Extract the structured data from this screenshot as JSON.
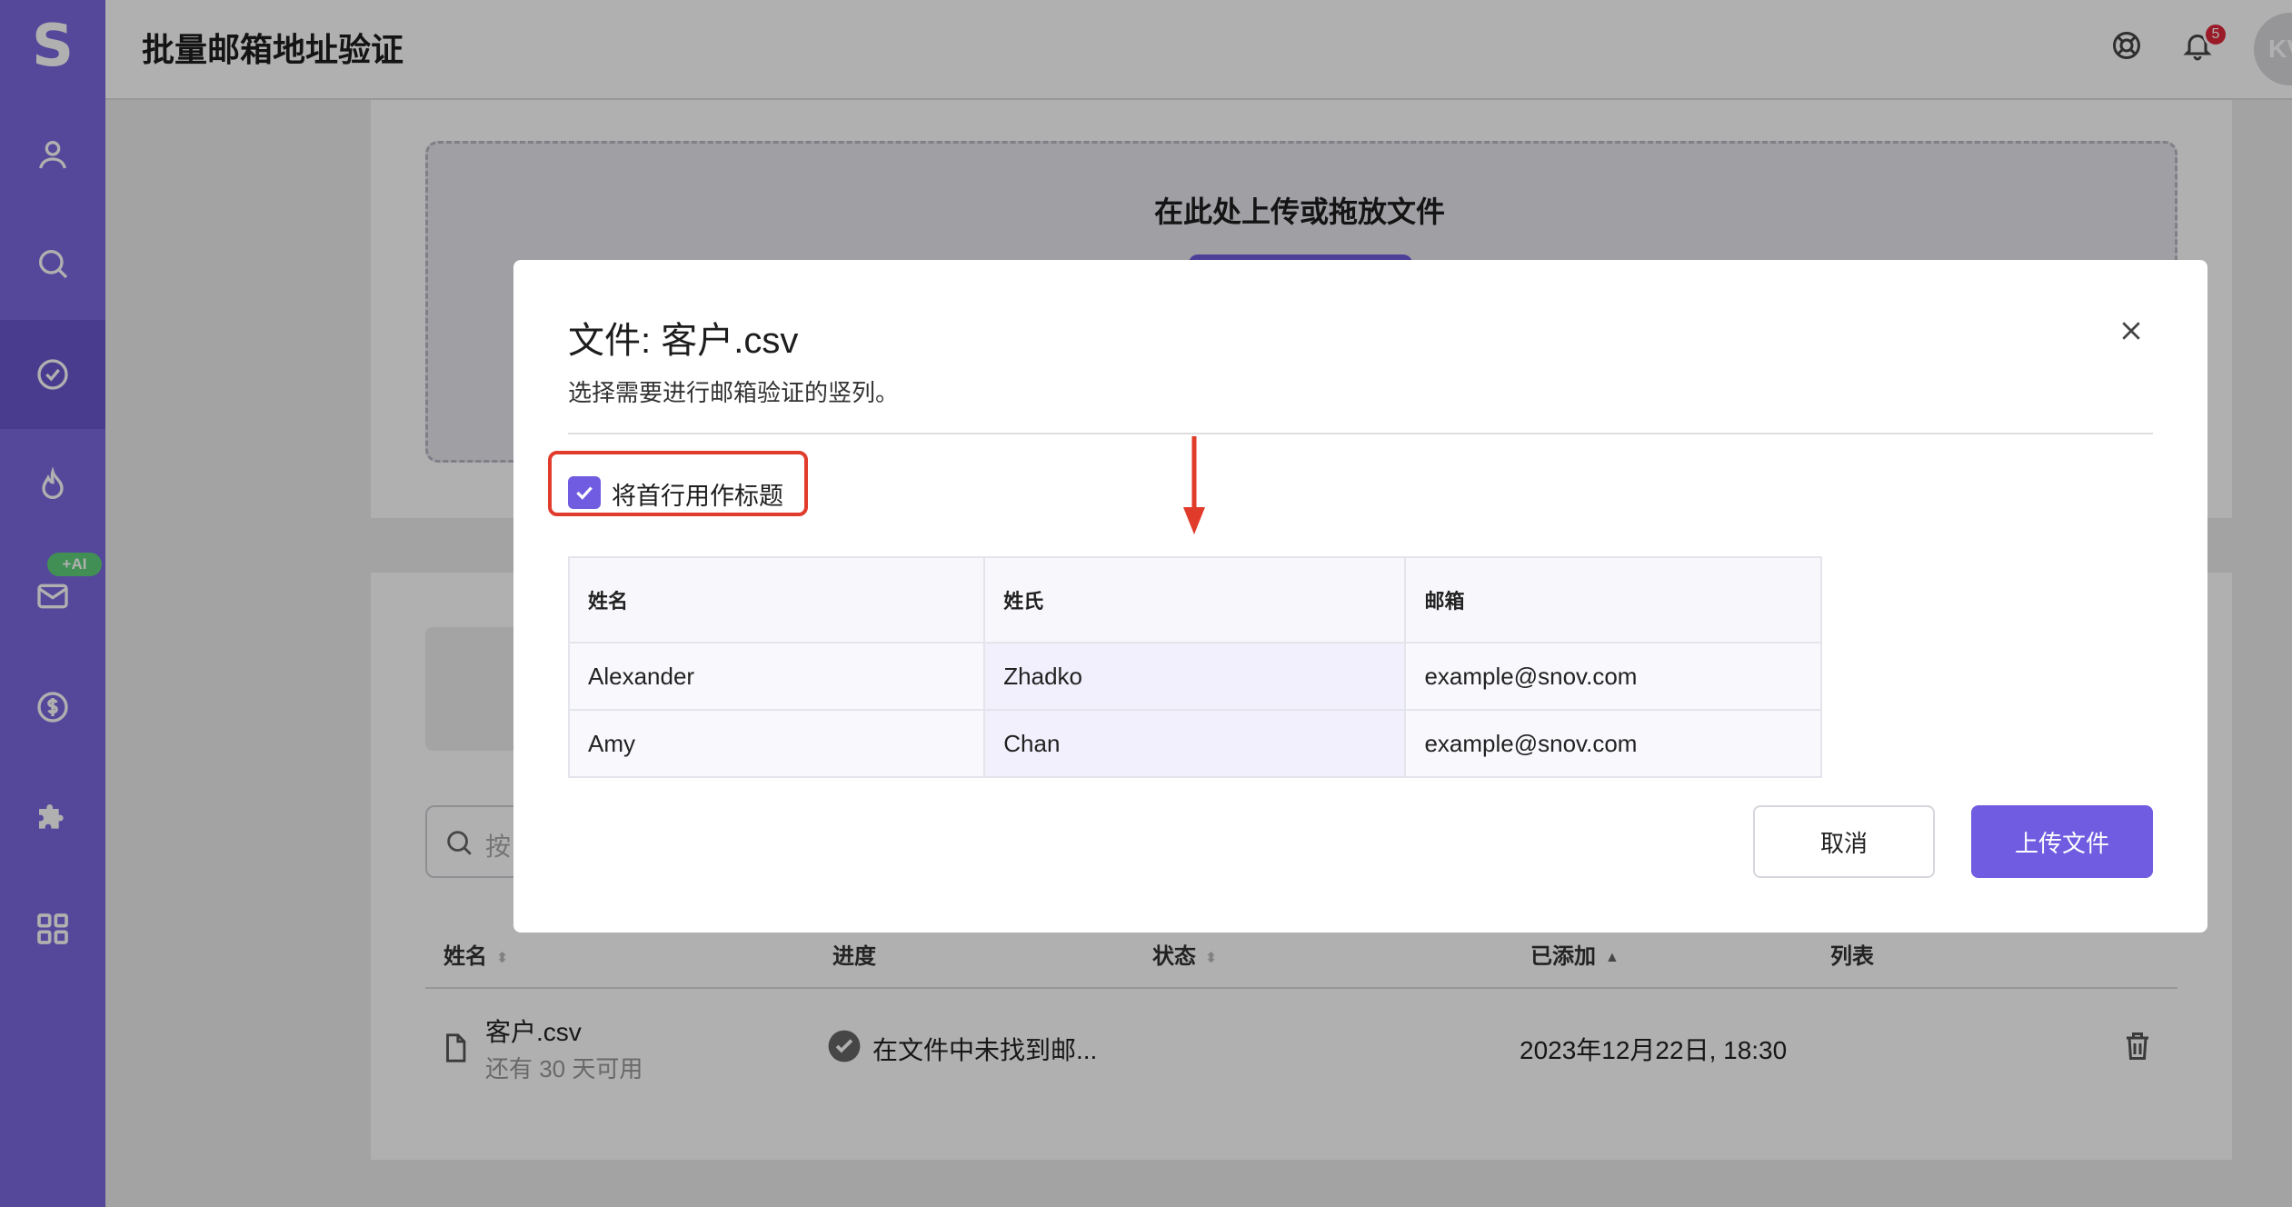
{
  "app": {
    "logo": "S",
    "page_title": "批量邮箱地址验证",
    "notification_count": "5",
    "avatar_initials": "KV"
  },
  "sidebar": {
    "ai_badge": "+AI",
    "items": [
      {
        "icon": "user-icon"
      },
      {
        "icon": "search-icon"
      },
      {
        "icon": "check-circle-icon",
        "active": true
      },
      {
        "icon": "fire-icon"
      },
      {
        "icon": "mail-icon"
      },
      {
        "icon": "dollar-icon"
      },
      {
        "icon": "puzzle-icon"
      },
      {
        "icon": "grid-icon"
      }
    ]
  },
  "upload_area": {
    "title": "在此处上传或拖放文件"
  },
  "search": {
    "placeholder": "按"
  },
  "files_table": {
    "headers": [
      "姓名",
      "进度",
      "状态",
      "已添加",
      "列表"
    ],
    "rows": [
      {
        "name": "客户.csv",
        "sub": "还有 30 天可用",
        "progress": "在文件中未找到邮...",
        "date": "2023年12月22日, 18:30"
      }
    ]
  },
  "modal": {
    "title": "文件: 客户.csv",
    "description": "选择需要进行邮箱验证的竖列。",
    "checkbox_label": "将首行用作标题",
    "checkbox_checked": true,
    "columns": [
      "姓名",
      "姓氏",
      "邮箱"
    ],
    "rows": [
      [
        "Alexander",
        "Zhadko",
        "example@snov.com"
      ],
      [
        "Amy",
        "Chan",
        "example@snov.com"
      ]
    ],
    "cancel_label": "取消",
    "upload_label": "上传文件"
  },
  "colors": {
    "brand": "#7b69e0",
    "button": "#6f5ce0",
    "highlight": "#e03b2b"
  }
}
